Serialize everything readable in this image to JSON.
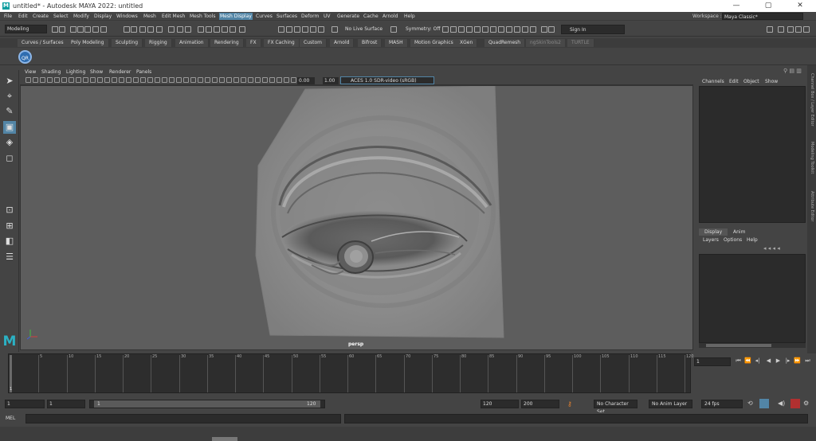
{
  "app": {
    "title": "untitled* - Autodesk MAYA 2022: untitled",
    "logo": "M"
  },
  "window_controls": {
    "minimize": "—",
    "maximize": "▢",
    "close": "✕"
  },
  "menubar": [
    "File",
    "Edit",
    "Create",
    "Select",
    "Modify",
    "Display",
    "Windows",
    "Mesh",
    "Edit Mesh",
    "Mesh Tools",
    "Mesh Display",
    "Curves",
    "Surfaces",
    "Deform",
    "UV",
    "Generate",
    "Cache",
    "Arnold",
    "Help"
  ],
  "menubar_active": "Mesh Display",
  "workspace": {
    "label": "Workspace :",
    "value": "Maya Classic*"
  },
  "status_line": {
    "mode": "Modeling",
    "live_surface": "No Live Surface",
    "symmetry": "Symmetry: Off",
    "sign_in": "Sign In"
  },
  "shelf_tabs": [
    "Curves / Surfaces",
    "Poly Modeling",
    "Sculpting",
    "Rigging",
    "Animation",
    "Rendering",
    "FX",
    "FX Caching",
    "Custom",
    "Arnold",
    "Bifrost",
    "MASH",
    "Motion Graphics",
    "XGen",
    "QuadRemesh",
    "ngSkinTools2",
    "TURTLE"
  ],
  "shelf_tabs_dim": [
    "ngSkinTools2",
    "TURTLE"
  ],
  "shelf": {
    "qr_button": "QR"
  },
  "viewport_menu": [
    "View",
    "Shading",
    "Lighting",
    "Show",
    "Renderer",
    "Panels"
  ],
  "viewport_toolbar": {
    "exposure": "0.00",
    "gamma": "1.00",
    "color_space": "ACES 1.0 SDR-video (sRGB)"
  },
  "viewport": {
    "camera": "persp"
  },
  "channel_box": {
    "menu": [
      "Channels",
      "Edit",
      "Object",
      "Show"
    ]
  },
  "layer_editor": {
    "tabs": [
      "Display",
      "Anim"
    ],
    "menu": [
      "Layers",
      "Options",
      "Help"
    ]
  },
  "side_tabs": [
    "Channel Box / Layer Editor",
    "Modeling Toolkit",
    "Attribute Editor"
  ],
  "time_slider": {
    "ticks": [
      "5",
      "10",
      "15",
      "20",
      "25",
      "30",
      "35",
      "40",
      "45",
      "50",
      "55",
      "60",
      "65",
      "70",
      "75",
      "80",
      "85",
      "90",
      "95",
      "100",
      "105",
      "110",
      "115",
      "120"
    ],
    "current_frame": "1",
    "playhead_frame": "1"
  },
  "range_slider": {
    "start": "1",
    "playback_start": "1",
    "range_start": "1",
    "range_end": "120",
    "playback_end": "120",
    "end": "200",
    "character_set": "No Character Set",
    "anim_layer": "No Anim Layer",
    "fps": "24 fps"
  },
  "command_line": {
    "label": "MEL"
  }
}
